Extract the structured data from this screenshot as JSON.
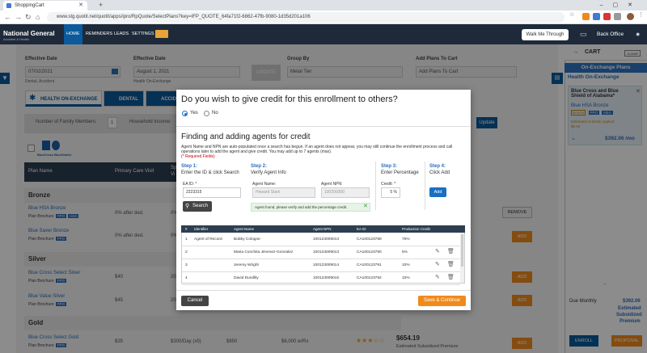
{
  "browser": {
    "tab_title": "ShoppingCart",
    "url": "www.stg.quotit.net/quotit/apps/ipro/RpQuote/SelectPlans?key=IFP_QUOTE_64fa71f2-6862-47fb-9080-1d35d201a106"
  },
  "app": {
    "logo": "National General",
    "logo_sub": "Accident & Health",
    "nav": [
      "HOME",
      "REMINDERS",
      "LEADS",
      "SETTINGS"
    ],
    "walk_me": "Walk Me Through",
    "back_office": "Back Office"
  },
  "bg": {
    "effective_date_label": "Effective Date",
    "effective_date": "07/02/2021",
    "effective_date_sub": "Dental, Accident",
    "effective_date2_label": "Effective Date",
    "effective_date2": "August 1, 2021",
    "effective_date2_sub": "Health On-Exchange",
    "group_by_label": "Group By",
    "group_by": "Metal Tier",
    "update_btn": "UPDATE",
    "add_plans_label": "Add Plans To Cart",
    "add_plans": "Add Plans To Cart",
    "tab_health": "HEALTH ON-EXCHANGE",
    "tab_health_sub": "8 PLANS",
    "tab_dental": "DENTAL",
    "tab_dental_sub": "16 PLANS",
    "tab_accident": "ACCIDE",
    "tab_accident_sub": "85 PLANS",
    "family_members": "Number of Family Members:",
    "family_count": "1",
    "household_income": "Household Income:",
    "update2": "Update",
    "carrier_logo": "BlueCross BlueShield",
    "col_plan_name": "Plan Name",
    "col_primary": "Primary Care Visit",
    "col_sp": "Sp",
    "col_sp2": "Vi",
    "sections": [
      "Bronze",
      "Silver",
      "Gold"
    ],
    "plans": [
      {
        "name": "Blue HSA Bronze",
        "primary": "0% after ded.",
        "sp": "0%",
        "action": "REMOVE"
      },
      {
        "name": "Blue Saver Bronze",
        "primary": "0% after ded.",
        "sp": "0%",
        "action": "ADD"
      },
      {
        "name": "Blue Cross Select Silver",
        "primary": "$40",
        "sp": "20",
        "action": "ADD"
      },
      {
        "name": "Blue Value Silver",
        "primary": "$45",
        "sp": "20",
        "action": "ADD"
      },
      {
        "name": "Blue Cross Select Gold",
        "primary": "$35",
        "sp": "$300/Day (x5)",
        "deductible": "$850",
        "oop": "$6,000 w/Rx",
        "price": "$654.19",
        "price_sub": "Estimated Subsidized Premium",
        "action": "ADD"
      }
    ],
    "plan_enroll": "Plan Brochure",
    "badge_hsa": "HSA",
    "badge_ppo": "PPO"
  },
  "cart": {
    "title": "CART",
    "clear": "CLEAR",
    "subheader": "On-Exchange Plans",
    "section": "Health On-Exchange",
    "item_name": "Blue Cross and Blue Shield of Alabama*",
    "item_plan": "Blue HSA Bronze",
    "item_badges": [
      "Bronze",
      "PPO",
      "HSA"
    ],
    "item_note": "Estimated Subsidy Applied:",
    "item_note_val": "$0.00",
    "item_price": "$392.06 /mo",
    "due_label": "Due Monthly",
    "due_amount": "$392.06",
    "due_sub1": "Estimated",
    "due_sub2": "Subsidized",
    "due_sub3": "Premium",
    "enroll": "ENROLL",
    "proposal": "PROPOSAL"
  },
  "modal": {
    "question": "Do you wish to give credit for this enrollment to others?",
    "yes": "Yes",
    "no": "No",
    "heading": "Finding and adding agents for credit",
    "instructions": "Agent Name and NPN are auto-populated once a search has begun. If an agent does not appear, you may still continue the enrollment process and call operations later to add the agent and give credit. You may add up to 7 agents (max).",
    "required": "(* Required Fields)",
    "step1": "Step 1:",
    "step1_sub": "Enter the ID & click Search",
    "step2": "Step 2:",
    "step2_sub": "Verify Agent Info",
    "step3": "Step 3:",
    "step3_sub": "Enter Percentage",
    "step4": "Step 4:",
    "step4_sub": "Click Add",
    "ea_id_label": "EA ID: *",
    "ea_id_value": "2223315",
    "agent_name_label": "Agent Name:",
    "agent_name_value": "Howard Stark",
    "agent_npn_label": "Agent NPN:",
    "agent_npn_value": "100200300",
    "credit_label": "Credit: *",
    "credit_value": "5 %",
    "search": "Search",
    "add": "Add",
    "found_msg": "Agent found, please verify and add the percentage credit.",
    "columns": [
      "#",
      "Identifier",
      "Agent Name",
      "Agent NPN",
      "EA ID",
      "Production Credit"
    ],
    "rows": [
      {
        "num": "1",
        "identifier": "Agent of Record",
        "name": "Bobby Cologne",
        "npn": "100123009013",
        "ea": "CA100123789",
        "credit": "75%"
      },
      {
        "num": "2",
        "identifier": "",
        "name": "Maria Conchita Jimenez-Gonzalez",
        "npn": "100123009013",
        "ea": "CA100123790",
        "credit": "5%"
      },
      {
        "num": "3",
        "identifier": "",
        "name": "Jeremy Wright",
        "npn": "100123009014",
        "ea": "CA100123791",
        "credit": "10%"
      },
      {
        "num": "4",
        "identifier": "",
        "name": "David Dundlily",
        "npn": "100123009015",
        "ea": "CA100123792",
        "credit": "10%"
      }
    ],
    "cancel": "Cancel",
    "save": "Save & Continue"
  }
}
